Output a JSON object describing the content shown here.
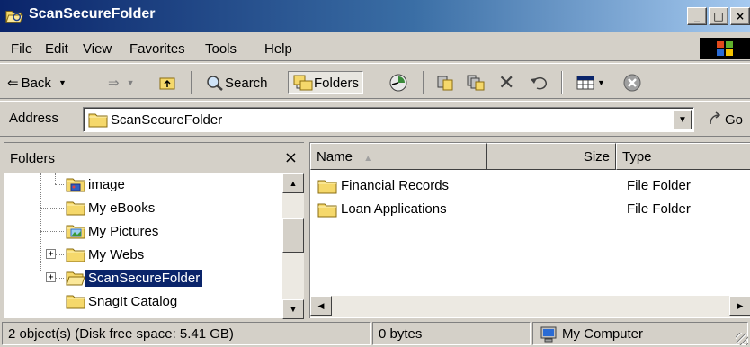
{
  "window": {
    "title": "ScanSecureFolder",
    "buttons": {
      "minimize": "_",
      "maximize": "□",
      "close": "×"
    }
  },
  "menu": [
    "File",
    "Edit",
    "View",
    "Favorites",
    "Tools",
    "Help"
  ],
  "toolbar": {
    "back_label": "Back",
    "search_label": "Search",
    "folders_label": "Folders"
  },
  "address": {
    "label": "Address",
    "value": "ScanSecureFolder",
    "go_label": "Go"
  },
  "folders_pane": {
    "title": "Folders",
    "close_glyph": "×",
    "items": [
      {
        "label": "image",
        "icon": "image-folder-icon",
        "expander": "",
        "selected": false
      },
      {
        "label": "My eBooks",
        "icon": "folder-icon",
        "expander": "",
        "selected": false
      },
      {
        "label": "My Pictures",
        "icon": "pictures-folder-icon",
        "expander": "",
        "selected": false
      },
      {
        "label": "My Webs",
        "icon": "folder-icon",
        "expander": "+",
        "selected": false
      },
      {
        "label": "ScanSecureFolder",
        "icon": "open-folder-icon",
        "expander": "+",
        "selected": true
      },
      {
        "label": "SnagIt Catalog",
        "icon": "folder-icon",
        "expander": "",
        "selected": false
      }
    ]
  },
  "content": {
    "columns": {
      "name": "Name",
      "size": "Size",
      "type": "Type"
    },
    "files": [
      {
        "name": "Financial Records",
        "type": "File Folder"
      },
      {
        "name": "Loan Applications",
        "type": "File Folder"
      }
    ]
  },
  "statusbar": {
    "objects": "2 object(s) (Disk free space: 5.41 GB)",
    "size": "0 bytes",
    "zone": "My Computer"
  },
  "colors": {
    "title_start": "#0a246a",
    "title_end": "#a6caf0",
    "selection": "#0a246a",
    "face": "#d4d0c8",
    "folder": "#f5d86b"
  }
}
